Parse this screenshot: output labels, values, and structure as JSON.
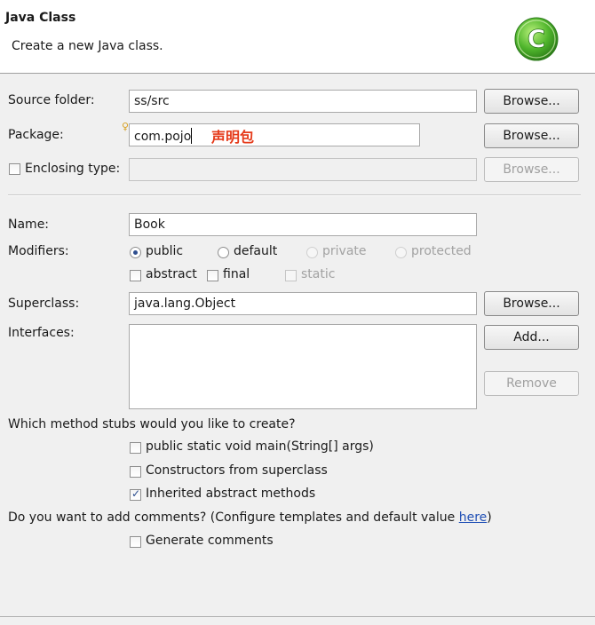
{
  "header": {
    "title": "Java Class",
    "description": "Create a new Java class."
  },
  "source_folder": {
    "label": "Source folder:",
    "value": "ss/src",
    "browse_label": "Browse..."
  },
  "package": {
    "label": "Package:",
    "value": "com.pojo",
    "browse_label": "Browse...",
    "annotation": "声明包"
  },
  "enclosing_type": {
    "label": "Enclosing type:",
    "value": "",
    "checked": false,
    "browse_label": "Browse..."
  },
  "name": {
    "label": "Name:",
    "value": "Book"
  },
  "modifiers": {
    "label": "Modifiers:",
    "radios": {
      "public": "public",
      "default": "default",
      "private": "private",
      "protected": "protected"
    },
    "selected": "public",
    "checks": {
      "abstract": "abstract",
      "final": "final",
      "static": "static"
    }
  },
  "superclass": {
    "label": "Superclass:",
    "value": "java.lang.Object",
    "browse_label": "Browse..."
  },
  "interfaces": {
    "label": "Interfaces:",
    "add_label": "Add...",
    "remove_label": "Remove",
    "items": []
  },
  "stubs": {
    "question": "Which method stubs would you like to create?",
    "main": {
      "label": "public static void main(String[] args)",
      "checked": false
    },
    "constructors": {
      "label": "Constructors from superclass",
      "checked": false
    },
    "inherited": {
      "label": "Inherited abstract methods",
      "checked": true
    }
  },
  "comments": {
    "question_prefix": "Do you want to add comments? (Configure templates and default value ",
    "link": "here",
    "question_suffix": ")",
    "generate": {
      "label": "Generate comments",
      "checked": false
    }
  },
  "colors": {
    "accent": "#2f4f90",
    "annotation": "#e53a1a",
    "link": "#1f4fb5",
    "logo": "#3fae2a"
  },
  "icons": {
    "logo": "class-wizard-c-icon"
  }
}
